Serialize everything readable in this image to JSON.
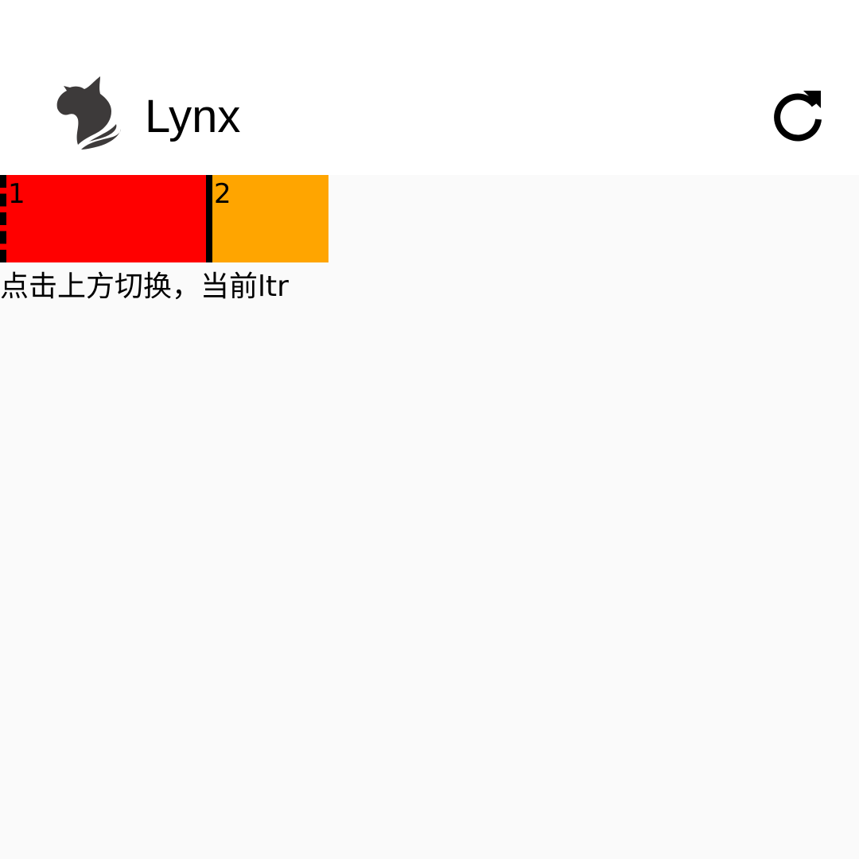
{
  "app_bar": {
    "title": "Lynx",
    "logo_icon": "lynx-cat-logo",
    "refresh_icon": "refresh-icon"
  },
  "demo": {
    "boxes": [
      {
        "label": "1",
        "color": "#ff0000",
        "border_left": "dashed",
        "border_right": "solid"
      },
      {
        "label": "2",
        "color": "#ffa500"
      }
    ],
    "status_text": "点击上方切换，当前ltr"
  },
  "colors": {
    "app_bar_bg": "#ffffff",
    "content_bg": "#fafafa",
    "border": "#000000"
  }
}
